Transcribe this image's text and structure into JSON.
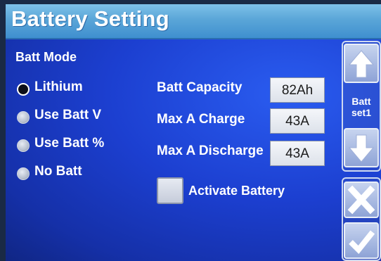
{
  "title": "Battery Setting",
  "batt_mode": {
    "heading": "Batt Mode",
    "options": [
      {
        "label": "Lithium",
        "selected": true
      },
      {
        "label": "Use Batt V",
        "selected": false
      },
      {
        "label": "Use Batt %",
        "selected": false
      },
      {
        "label": "No Batt",
        "selected": false
      }
    ]
  },
  "fields": [
    {
      "label": "Batt Capacity",
      "value": "82Ah"
    },
    {
      "label": "Max A Charge",
      "value": "43A"
    },
    {
      "label": "Max A Discharge",
      "value": "43A"
    }
  ],
  "activate": {
    "label": "Activate Battery",
    "checked": false
  },
  "side": {
    "page_label_line1": "Batt",
    "page_label_line2": "set1",
    "up_icon": "arrow-up-icon",
    "down_icon": "arrow-down-icon",
    "cancel_icon": "x-icon",
    "confirm_icon": "check-icon"
  },
  "colors": {
    "background": "#1c3fd0",
    "titlebar": "#5aa6d8",
    "text": "#ffffff"
  }
}
